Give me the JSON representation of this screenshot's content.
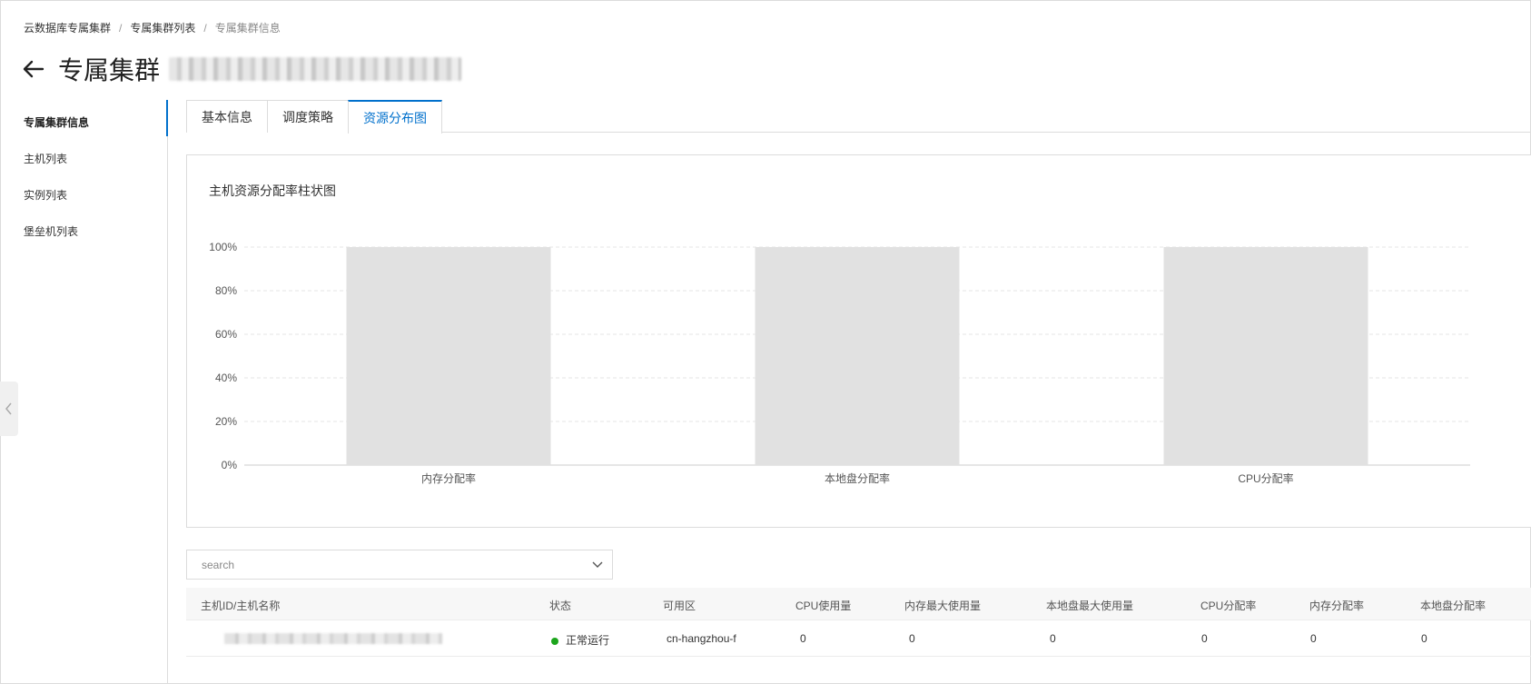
{
  "breadcrumb": {
    "items": [
      "云数据库专属集群",
      "专属集群列表",
      "专属集群信息"
    ],
    "separator": "/"
  },
  "header": {
    "title": "专属集群"
  },
  "sidebar": {
    "items": [
      {
        "label": "专属集群信息",
        "active": true
      },
      {
        "label": "主机列表",
        "active": false
      },
      {
        "label": "实例列表",
        "active": false
      },
      {
        "label": "堡垒机列表",
        "active": false
      }
    ]
  },
  "tabs": [
    {
      "label": "基本信息",
      "active": false
    },
    {
      "label": "调度策略",
      "active": false
    },
    {
      "label": "资源分布图",
      "active": true
    }
  ],
  "chart_data": {
    "type": "bar",
    "title": "主机资源分配率柱状图",
    "categories": [
      "内存分配率",
      "本地盘分配率",
      "CPU分配率"
    ],
    "values": [
      100,
      100,
      100
    ],
    "yticks": [
      "0%",
      "20%",
      "40%",
      "60%",
      "80%",
      "100%"
    ],
    "ylim": [
      0,
      100
    ],
    "grid": true,
    "bar_color": "#e1e1e1"
  },
  "search": {
    "placeholder": "search",
    "value": ""
  },
  "table": {
    "columns": [
      "主机ID/主机名称",
      "状态",
      "可用区",
      "CPU使用量",
      "内存最大使用量",
      "本地盘最大使用量",
      "CPU分配率",
      "内存分配率",
      "本地盘分配率"
    ],
    "rows": [
      {
        "status": "正常运行",
        "status_color": "#1ca51c",
        "zone": "cn-hangzhou-f",
        "cpu_usage": "0",
        "mem_max": "0",
        "disk_max": "0",
        "cpu_alloc": "0",
        "mem_alloc": "0",
        "disk_alloc": "0"
      }
    ]
  },
  "colors": {
    "accent": "#0070cc",
    "border": "#dcdcdc"
  }
}
